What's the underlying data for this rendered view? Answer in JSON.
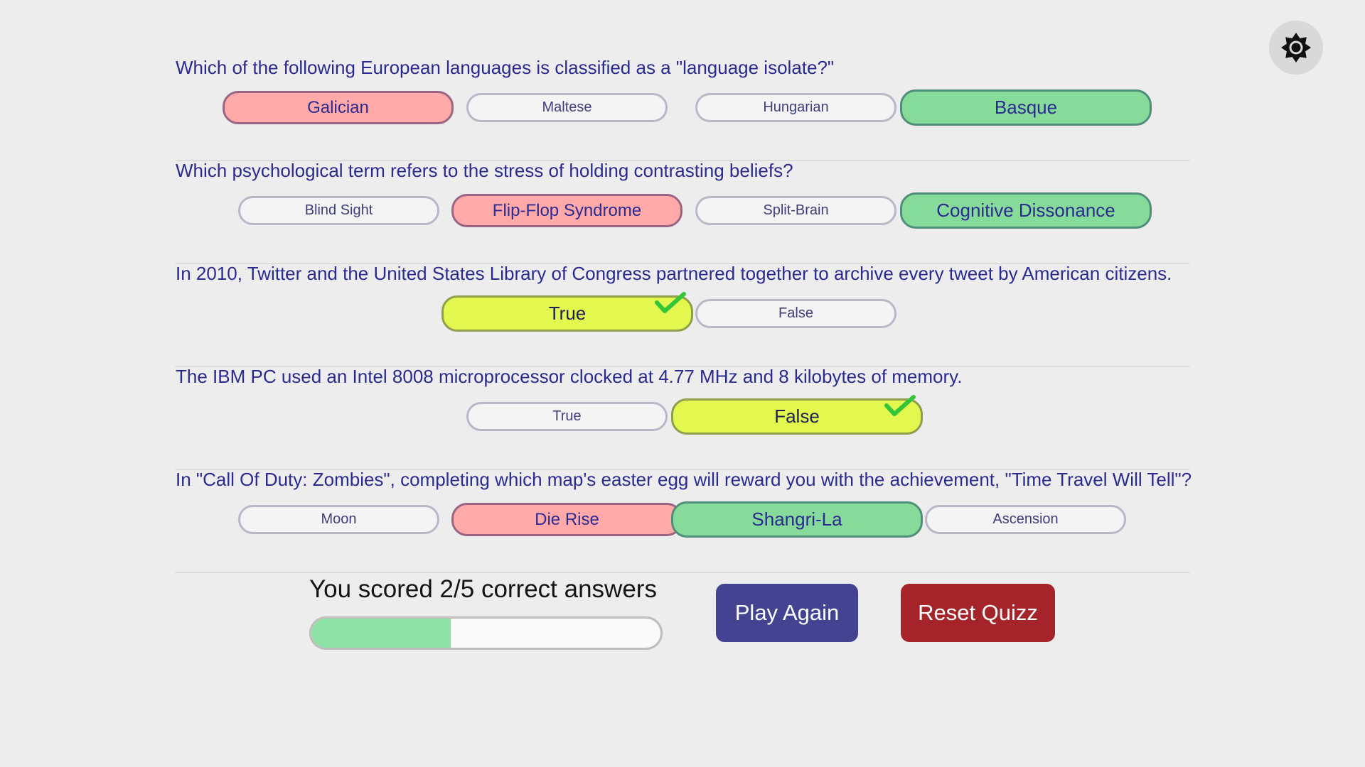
{
  "settings": {
    "icon": "gear-icon"
  },
  "colors": {
    "wrong": "#ffa9a9",
    "correct": "#86db9a",
    "selected_correct": "#e2f84e",
    "check": "#35c53a",
    "play_button": "#434391",
    "reset_button": "#a5242a"
  },
  "questions": [
    {
      "text": "Which of the following European languages is classified as a \"language isolate?\"",
      "answers": [
        {
          "label": "Galician",
          "state": "wrong"
        },
        {
          "label": "Maltese",
          "state": "plain"
        },
        {
          "label": "Hungarian",
          "state": "plain"
        },
        {
          "label": "Basque",
          "state": "correct"
        }
      ]
    },
    {
      "text": "Which psychological term refers to the stress of holding contrasting beliefs?",
      "answers": [
        {
          "label": "Blind Sight",
          "state": "plain"
        },
        {
          "label": "Flip-Flop Syndrome",
          "state": "wrong"
        },
        {
          "label": "Split-Brain",
          "state": "plain"
        },
        {
          "label": "Cognitive Dissonance",
          "state": "correct"
        }
      ]
    },
    {
      "text": "In 2010, Twitter and the United States Library of Congress partnered together to archive every tweet by American citizens.",
      "answers": [
        {
          "label": "True",
          "state": "selected-correct"
        },
        {
          "label": "False",
          "state": "plain"
        }
      ]
    },
    {
      "text": "The IBM PC used an Intel 8008 microprocessor clocked at 4.77 MHz and 8 kilobytes of memory.",
      "answers": [
        {
          "label": "True",
          "state": "plain"
        },
        {
          "label": "False",
          "state": "selected-correct"
        }
      ]
    },
    {
      "text": "In \"Call Of Duty: Zombies\", completing which map's easter egg will reward you with the achievement, \"Time Travel Will Tell\"?",
      "answers": [
        {
          "label": "Moon",
          "state": "plain"
        },
        {
          "label": "Die Rise",
          "state": "wrong"
        },
        {
          "label": "Shangri-La",
          "state": "correct"
        },
        {
          "label": "Ascension",
          "state": "plain"
        }
      ]
    }
  ],
  "result": {
    "score_text": "You scored 2/5 correct answers",
    "score_fraction": 0.4
  },
  "buttons": {
    "play_again": "Play Again",
    "reset_quiz": "Reset Quizz"
  }
}
